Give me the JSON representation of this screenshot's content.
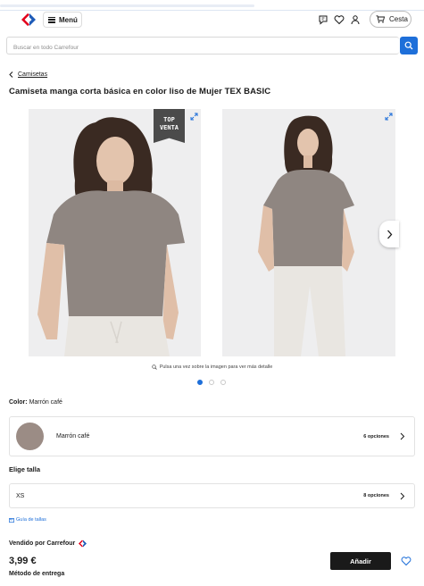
{
  "header": {
    "menu_label": "Menú",
    "cart_label": "Cesta"
  },
  "search": {
    "placeholder": "Buscar en todo Carrefour"
  },
  "breadcrumb": {
    "label": "Camisetas"
  },
  "product": {
    "title": "Camiseta manga corta básica en color liso de Mujer TEX BASIC",
    "badge_line1": "TOP",
    "badge_line2": "VENTA",
    "image_hint": "Pulsa una vez sobre la imagen para ver más detalle",
    "gallery": {
      "image_count": 3,
      "active_index": 0
    }
  },
  "color": {
    "label": "Color:",
    "value": "Marrón café",
    "swatch_color": "#9b8c85",
    "option_name": "Marrón café",
    "options_count": "6 opciones"
  },
  "size": {
    "title": "Elige talla",
    "value": "XS",
    "options_count": "8 opciones",
    "guide_label": "Guía de tallas"
  },
  "purchase": {
    "seller": "Vendido por Carrefour",
    "price": "3,99 €",
    "delivery_title": "Método de entrega",
    "add_button": "Añadir"
  },
  "colors": {
    "accent": "#1e6fd9",
    "brand_red": "#e3001b",
    "brand_blue": "#1e5bb8",
    "dark": "#1a1a1a"
  }
}
